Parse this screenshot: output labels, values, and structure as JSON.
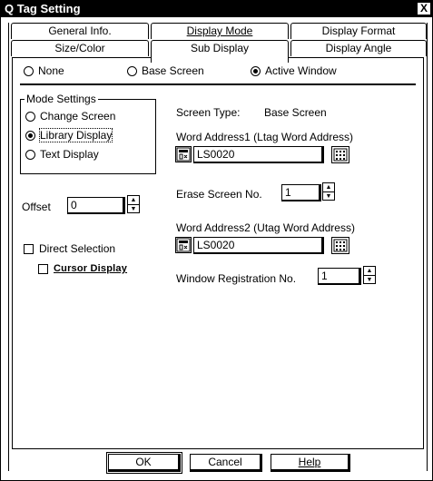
{
  "window": {
    "title": "Q Tag Setting",
    "close_glyph": "X"
  },
  "tabs_row1": [
    {
      "label": "General Info."
    },
    {
      "label": "Display Mode"
    },
    {
      "label": "Display Format"
    }
  ],
  "tabs_row2": [
    {
      "label": "Size/Color"
    },
    {
      "label": "Sub Display",
      "active": true
    },
    {
      "label": "Display Angle"
    }
  ],
  "display_target": {
    "options": [
      {
        "label": "None",
        "selected": false
      },
      {
        "label": "Base Screen",
        "selected": false
      },
      {
        "label": "Active Window",
        "selected": true
      }
    ]
  },
  "mode_settings": {
    "legend": "Mode Settings",
    "options": [
      {
        "label": "Change Screen",
        "selected": false
      },
      {
        "label": "Library Display",
        "selected": true
      },
      {
        "label": "Text Display",
        "selected": false
      }
    ]
  },
  "screen_type": {
    "label": "Screen Type:",
    "value": "Base Screen"
  },
  "word_address1": {
    "label": "Word Address1   (Ltag Word Address)",
    "value": "LS0020"
  },
  "erase_screen": {
    "label": "Erase Screen No.",
    "value": "1"
  },
  "offset": {
    "label": "Offset",
    "value": "0"
  },
  "word_address2": {
    "label": "Word Address2 (Utag Word Address)",
    "value": "LS0020"
  },
  "window_registration": {
    "label": "Window Registration No.",
    "value": "1"
  },
  "direct_selection": {
    "label": "Direct Selection",
    "checked": false
  },
  "cursor_display": {
    "label": "Cursor Display",
    "checked": false,
    "enabled": false
  },
  "buttons": {
    "ok": "OK",
    "cancel": "Cancel",
    "help": "Help"
  },
  "icons": {
    "address_icon": "address-input-icon",
    "keypad_icon": "keypad-icon"
  }
}
